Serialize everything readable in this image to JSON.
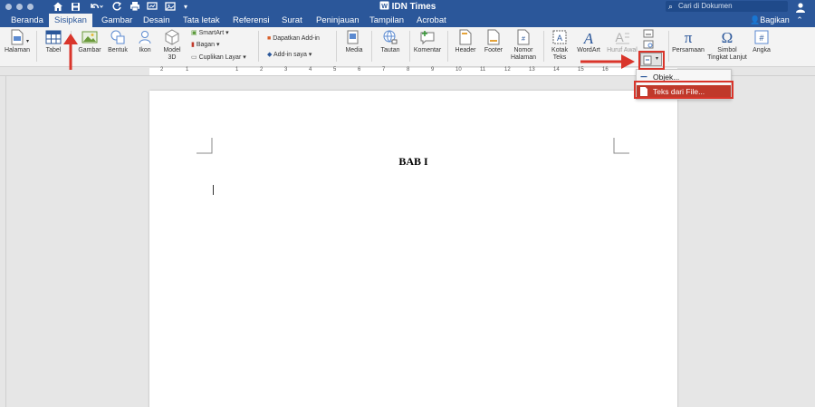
{
  "window": {
    "title": "IDN Times",
    "search_placeholder": "Cari di Dokumen",
    "share_label": "Bagikan"
  },
  "tabs": [
    {
      "label": "Beranda"
    },
    {
      "label": "Sisipkan"
    },
    {
      "label": "Gambar"
    },
    {
      "label": "Desain"
    },
    {
      "label": "Tata letak"
    },
    {
      "label": "Referensi"
    },
    {
      "label": "Surat"
    },
    {
      "label": "Peninjauan"
    },
    {
      "label": "Tampilan"
    },
    {
      "label": "Acrobat"
    }
  ],
  "ribbon": {
    "halaman": "Halaman",
    "tabel": "Tabel",
    "gambar": "Gambar",
    "bentuk": "Bentuk",
    "ikon": "Ikon",
    "model3d_1": "Model",
    "model3d_2": "3D",
    "smartart": "SmartArt",
    "bagan": "Bagan",
    "cuplikan": "Cuplikan Layar",
    "dapatkan_addin": "Dapatkan Add-in",
    "addin_saya": "Add-in saya",
    "media": "Media",
    "tautan": "Tautan",
    "komentar": "Komentar",
    "header": "Header",
    "footer": "Footer",
    "nomor_1": "Nomor",
    "nomor_2": "Halaman",
    "kotak_1": "Kotak",
    "kotak_2": "Teks",
    "wordart": "WordArt",
    "huruf_awal": "Huruf Awal",
    "persamaan": "Persamaan",
    "simbol_1": "Simbol",
    "simbol_2": "Tingkat Lanjut",
    "angka": "Angka"
  },
  "ruler_numbers": [
    "2",
    "1",
    "1",
    "2",
    "3",
    "4",
    "5",
    "6",
    "7",
    "8",
    "9",
    "10",
    "11",
    "12",
    "13",
    "14",
    "15",
    "16"
  ],
  "menu": {
    "objek": "Objek...",
    "teks_dari_file": "Teks dari File..."
  },
  "document": {
    "heading": "BAB I"
  },
  "colors": {
    "accent": "#2b579a",
    "highlight": "#d9352b"
  }
}
